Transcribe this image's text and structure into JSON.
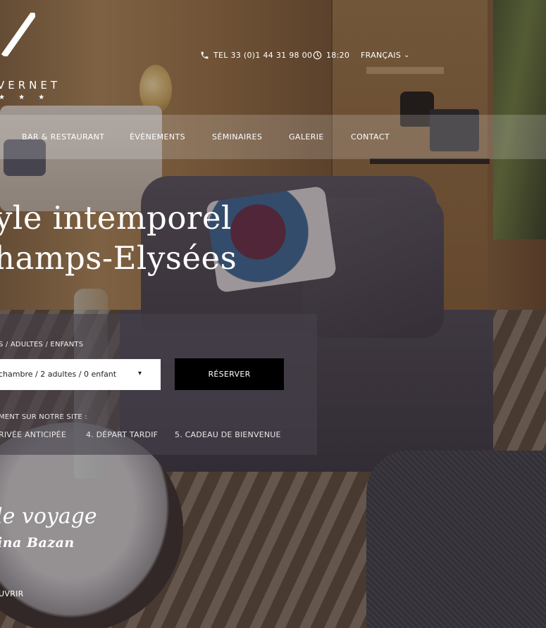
{
  "logo": {
    "name": "VERNET",
    "stars": "★ ★ ★"
  },
  "topbar": {
    "phone": "TEL 33 (0)1 44 31 98 00",
    "time": "18:20",
    "language": "FRANÇAIS"
  },
  "nav": {
    "items": [
      "BAR & RESTAURANT",
      "ÈVÈNEMENTS",
      "SÉMINAIRES",
      "GALERIE",
      "CONTACT"
    ]
  },
  "hero": {
    "line1": "yle intemporel",
    "line2": "hamps-Elysées"
  },
  "booking": {
    "label": "S / ADULTES / ENFANTS",
    "select_value": "chambre / 2 adultes / 0 enfant",
    "button": "RÉSERVER",
    "perks_title": "MENT SUR NOTRE SITE :",
    "perks": [
      "RIVÉE ANTICIPÉE",
      "4. DÉPART TARDIF",
      "5. CADEAU DE BIENVENUE"
    ]
  },
  "story": {
    "title": "le voyage",
    "author": "ina Bazan",
    "cta": "UVRIR"
  },
  "icons": {
    "phone": "phone-icon",
    "clock": "clock-icon",
    "chevron": "chevron-down-icon"
  }
}
